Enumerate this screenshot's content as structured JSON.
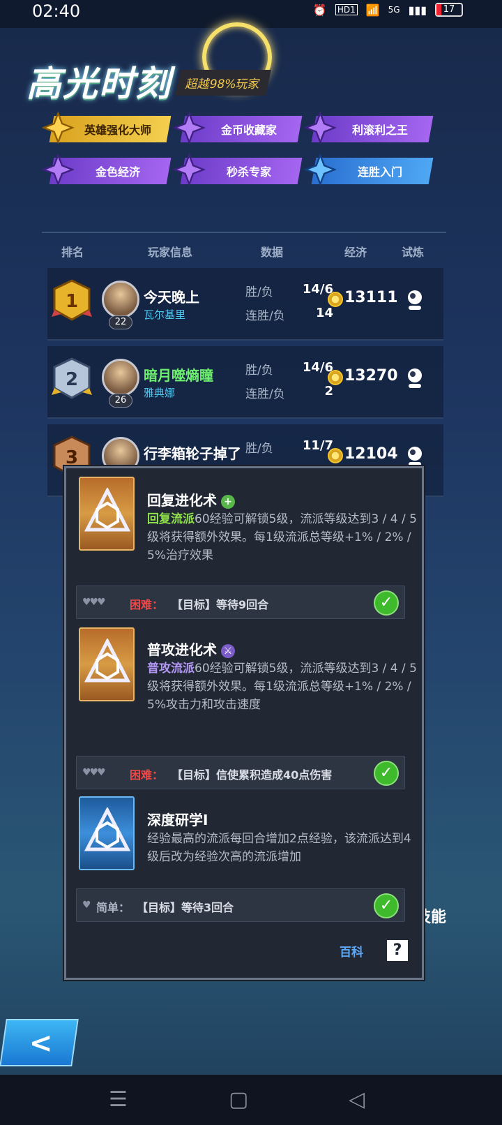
{
  "status": {
    "time": "02:40",
    "hd": "HD1",
    "network": "5G",
    "battery": "17"
  },
  "header": {
    "title": "高光时刻",
    "subtitle": "超越98%玩家"
  },
  "badges": [
    {
      "label": "英雄强化大师",
      "style": "gold"
    },
    {
      "label": "金币收藏家",
      "style": "purple"
    },
    {
      "label": "利滚利之王",
      "style": "purple"
    },
    {
      "label": "金色经济",
      "style": "purple"
    },
    {
      "label": "秒杀专家",
      "style": "purple"
    },
    {
      "label": "连胜入门",
      "style": "blue"
    }
  ],
  "columns": {
    "rank": "排名",
    "player": "玩家信息",
    "data": "数据",
    "economy": "经济",
    "trial": "试炼"
  },
  "rows": [
    {
      "rank": "1",
      "name": "今天晚上",
      "hero": "瓦尔基里",
      "level": "22",
      "wl_label": "胜/负",
      "wl": "14/6",
      "streak_label": "连胜/负",
      "streak": "14",
      "money": "13111"
    },
    {
      "rank": "2",
      "name": "暗月噬熵瞳",
      "hero": "雅典娜",
      "level": "26",
      "wl_label": "胜/负",
      "wl": "14/6",
      "streak_label": "连胜/负",
      "streak": "2",
      "money": "13270"
    },
    {
      "rank": "3",
      "name": "行李箱轮子掉了",
      "hero": "",
      "level": "",
      "wl_label": "胜/负",
      "wl": "11/7",
      "streak_label": "",
      "streak": "",
      "money": "12104"
    }
  ],
  "popup": {
    "cards": [
      {
        "title": "回复进化术",
        "tag": "+",
        "highlight": "回复流派",
        "desc": "60经验可解锁5级，流派等级达到3 / 4 / 5级将获得额外效果。每1级流派总等级+1% / 2% / 5%治疗效果",
        "task_prefix": "困难：",
        "task": "【目标】等待9回合",
        "hearts": "♥♥♥"
      },
      {
        "title": "普攻进化术",
        "tag": "⚔",
        "highlight": "普攻流派",
        "desc": "60经验可解锁5级，流派等级达到3 / 4 / 5级将获得额外效果。每1级流派总等级+1% / 2% / 5%攻击力和攻击速度",
        "task_prefix": "困难：",
        "task": "【目标】信使累积造成40点伤害",
        "hearts": "♥♥♥"
      },
      {
        "title": "深度研学I",
        "tag": "",
        "highlight": "",
        "desc": "经验最高的流派每回合增加2点经验，该流派达到4级后改为经验次高的流派增加",
        "task_prefix": "简单：",
        "task": "【目标】等待3回合",
        "hearts": "♥"
      }
    ],
    "wiki": "百科",
    "wiki_icon": "?"
  },
  "side_text": "技能",
  "back_label": "<",
  "nav": {
    "menu": "☰",
    "home": "▢",
    "back": "◁"
  }
}
